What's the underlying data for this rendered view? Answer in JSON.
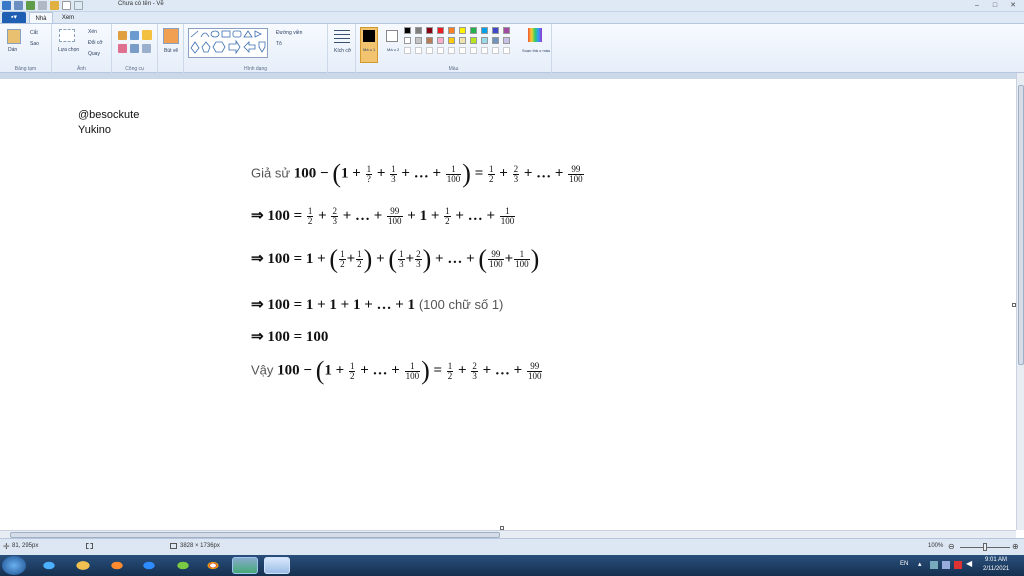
{
  "window": {
    "title": "Chưa có tên - Vẽ"
  },
  "tabs": {
    "file": "▪▾",
    "home": "Nhà",
    "view": "Xem"
  },
  "ribbon": {
    "paste": "Dán",
    "cut": "Cắt",
    "copy": "Sao",
    "clipboard_group": "Bảng tạm",
    "select": "Lựa chọn",
    "crop": "Xén",
    "resize": "Đổi cỡ",
    "rotate": "Quay",
    "image_group": "Ảnh",
    "tools_group": "Công cụ",
    "brushes": "Bút vẽ",
    "shapes_group": "Hình dạng",
    "outline": "Đường viền",
    "fill": "Tô",
    "size": "Kích cỡ",
    "color1": "Mà u 1",
    "color2": "Mà u 2",
    "colors_group": "Màu",
    "edit_colors": "Soạn thả o màu"
  },
  "palette": [
    "#000000",
    "#7f7f7f",
    "#880015",
    "#ed1c24",
    "#ff7f27",
    "#fff200",
    "#22b14c",
    "#00a2e8",
    "#3f48cc",
    "#a349a4",
    "#ffffff",
    "#c3c3c3",
    "#b97a57",
    "#ffaec9",
    "#ffc90e",
    "#efe4b0",
    "#b5e61d",
    "#99d9ea",
    "#7092be",
    "#c8bfe7"
  ],
  "canvas": {
    "author_line1": "@besockute",
    "author_line2": "Yukino",
    "math": {
      "l1_prefix": "Giả sử",
      "l1_a": "100 −",
      "l1_b": "1 +",
      "l1_c": "+",
      "l1_d": "+ … +",
      "l1_e": "=",
      "l1_f": "+",
      "l1_g": "+ … +",
      "l2_prefix": "⇒ 100 =",
      "l2_a": "+",
      "l2_b": "+ … +",
      "l2_c": "+ 1 +",
      "l2_d": "+ … +",
      "l3_prefix": "⇒ 100 = 1 +",
      "l3_plus": "+",
      "l3_dots": "+ … +",
      "l4_text": "⇒ 100 = 1 + 1 + 1 + … + 1",
      "l4_note": "(100 chữ số 1)",
      "l5_text": "⇒ 100 = 100",
      "l6_prefix": "Vậy",
      "l6_a": "100 −",
      "l6_b": "1 +",
      "l6_c": "+ … +",
      "l6_d": "=",
      "l6_e": "+",
      "l6_f": "+ … +",
      "f_1": "1",
      "f_2": "2",
      "f_3": "3",
      "f_99": "99",
      "f_100": "100",
      "f_q": "?"
    }
  },
  "status": {
    "cursor": "81, 295px",
    "canvas_size": "3828 × 1736px",
    "zoom": "100%"
  },
  "taskbar": {
    "lang": "EN",
    "time": "9:01 AM",
    "date": "2/11/2021"
  }
}
